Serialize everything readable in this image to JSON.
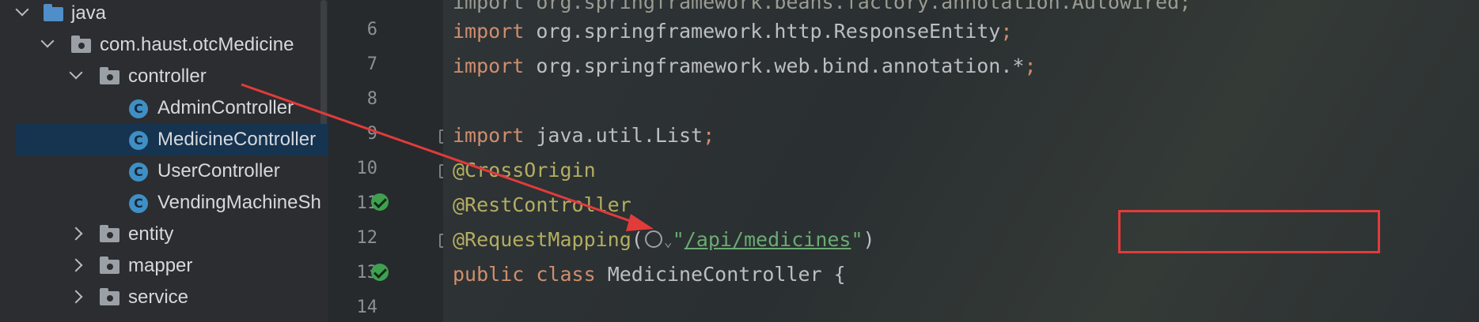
{
  "tree": {
    "items": [
      {
        "label": "java",
        "kind": "folder-blue",
        "chevron": "down"
      },
      {
        "label": "com.haust.otcMedicine",
        "kind": "package",
        "chevron": "down"
      },
      {
        "label": "controller",
        "kind": "package",
        "chevron": "down"
      },
      {
        "label": "AdminController",
        "kind": "class"
      },
      {
        "label": "MedicineController",
        "kind": "class",
        "selected": true
      },
      {
        "label": "UserController",
        "kind": "class"
      },
      {
        "label": "VendingMachineSh",
        "kind": "class"
      },
      {
        "label": "entity",
        "kind": "package",
        "chevron": "right"
      },
      {
        "label": "mapper",
        "kind": "package",
        "chevron": "right"
      },
      {
        "label": "service",
        "kind": "package",
        "chevron": "right"
      }
    ],
    "class_icon_letter": "C"
  },
  "gutter": {
    "line_numbers": [
      "6",
      "7",
      "8",
      "9",
      "10",
      "11",
      "12",
      "13",
      "14"
    ],
    "icons": [
      "bean-check-icon",
      "bean-check-icon"
    ]
  },
  "editor": {
    "lines": {
      "l6": {
        "kw": "import",
        "text": " org.springframework.http.ResponseEntity",
        "end": ";"
      },
      "l7": {
        "kw": "import",
        "text": " org.springframework.web.bind.annotation.",
        "mid": "*",
        "end": ";"
      },
      "l9": {
        "kw": "import",
        "text": " java.util.List",
        "end": ";"
      },
      "l10": {
        "ann": "@CrossOrigin"
      },
      "l11": {
        "ann": "@RestController"
      },
      "l12": {
        "ann": "@RequestMapping",
        "open": "(",
        "q1": "\"",
        "str": "/api/medicines",
        "q2": "\"",
        "close": ")"
      },
      "l13": {
        "kw1": "public",
        "kw2": "class",
        "text": " MedicineController {"
      }
    }
  },
  "colors": {
    "keyword": "#cf8e6d",
    "annotation": "#b3ae60",
    "string": "#6aab73",
    "annotation_box": "#e23b3b",
    "selection": "#163350"
  }
}
